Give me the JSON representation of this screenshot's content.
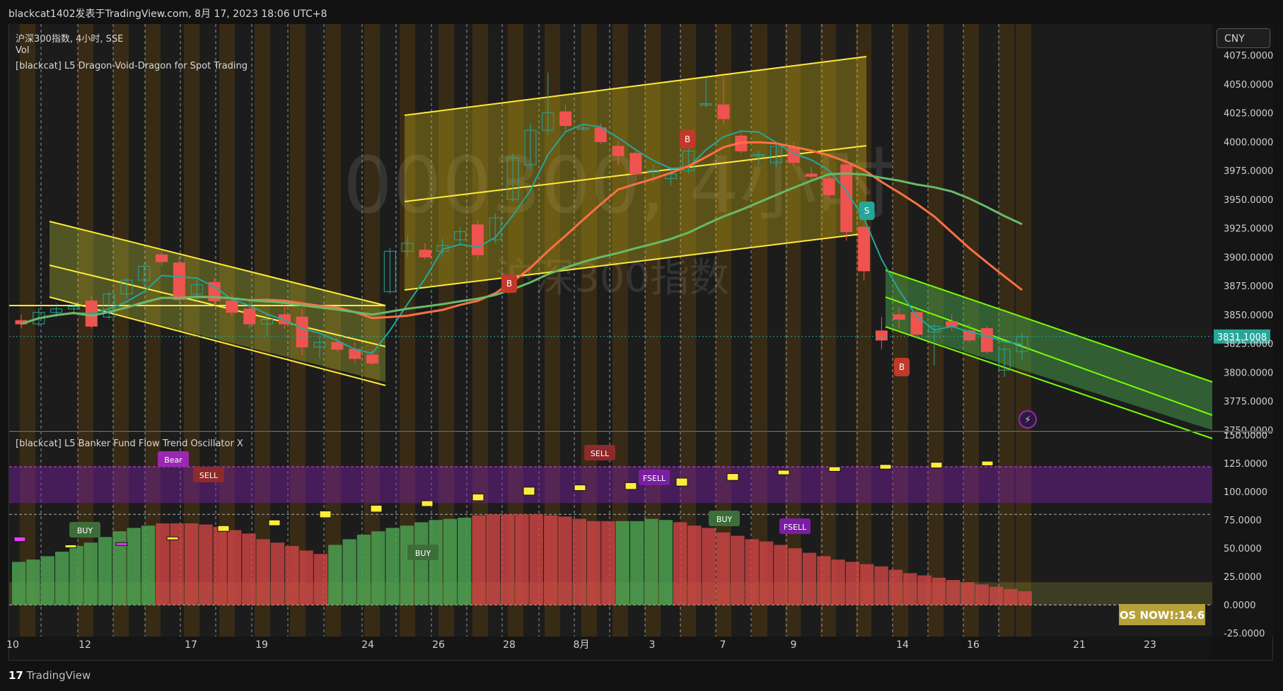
{
  "header": {
    "publisher": "blackcat1402发表于TradingView.com,  8月 17, 2023 18:06 UTC+8"
  },
  "legend": {
    "symbol": "沪深300指数, 4小时, SSE",
    "vol": "Vol",
    "indicator1": "[blackcat] L5 Dragon-Void-Dragon for Spot Trading",
    "indicator2": "[blackcat] L5 Banker Fund Flow Trend Oscillator X"
  },
  "currency": "CNY",
  "watermark": {
    "line1": "000300, 4小时",
    "line2": "沪深300指数"
  },
  "footer": {
    "brand": "TradingView"
  },
  "colors": {
    "up": "#26a69a",
    "down": "#ef5350",
    "yellow_channel": "#ffeb3b",
    "green_channel": "#76ff03",
    "price_tag": "#26a69a"
  },
  "chart_data": [
    {
      "type": "candlestick",
      "title": "沪深300指数, 4小时, SSE",
      "x_ticks": [
        "10",
        "12",
        "17",
        "19",
        "24",
        "26",
        "28",
        "8月",
        "3",
        "7",
        "9",
        "14",
        "16",
        "21",
        "23"
      ],
      "y_ticks": [
        3750,
        3775,
        3800,
        3825,
        3850,
        3875,
        3900,
        3925,
        3950,
        3975,
        4000,
        4025,
        4050,
        4075
      ],
      "ylim": [
        3750,
        4080
      ],
      "last_price": {
        "value": "3831.1008"
      },
      "candles": [
        [
          3845,
          3850,
          3838,
          3842
        ],
        [
          3842,
          3856,
          3840,
          3852
        ],
        [
          3852,
          3860,
          3848,
          3855
        ],
        [
          3855,
          3860,
          3850,
          3857
        ],
        [
          3862,
          3866,
          3838,
          3840
        ],
        [
          3848,
          3870,
          3846,
          3868
        ],
        [
          3868,
          3882,
          3864,
          3880
        ],
        [
          3880,
          3895,
          3876,
          3892
        ],
        [
          3902,
          3906,
          3892,
          3896
        ],
        [
          3895,
          3900,
          3860,
          3863
        ],
        [
          3868,
          3880,
          3862,
          3876
        ],
        [
          3878,
          3882,
          3858,
          3862
        ],
        [
          3862,
          3868,
          3848,
          3852
        ],
        [
          3855,
          3862,
          3838,
          3842
        ],
        [
          3842,
          3852,
          3832,
          3846
        ],
        [
          3850,
          3860,
          3838,
          3842
        ],
        [
          3848,
          3855,
          3815,
          3822
        ],
        [
          3822,
          3832,
          3812,
          3826
        ],
        [
          3826,
          3830,
          3818,
          3820
        ],
        [
          3820,
          3826,
          3808,
          3812
        ],
        [
          3815,
          3820,
          3806,
          3808
        ],
        [
          3870,
          3908,
          3868,
          3905
        ],
        [
          3905,
          3918,
          3900,
          3912
        ],
        [
          3906,
          3912,
          3898,
          3900
        ],
        [
          3905,
          3916,
          3900,
          3910
        ],
        [
          3915,
          3926,
          3910,
          3922
        ],
        [
          3928,
          3932,
          3898,
          3902
        ],
        [
          3915,
          3938,
          3912,
          3934
        ],
        [
          3950,
          3990,
          3948,
          3986
        ],
        [
          3980,
          4016,
          3976,
          4010
        ],
        [
          4010,
          4060,
          4006,
          4025
        ],
        [
          4026,
          4032,
          4010,
          4014
        ],
        [
          4012,
          4015,
          4010,
          4012
        ],
        [
          4012,
          4016,
          3998,
          4000
        ],
        [
          3996,
          4000,
          3980,
          3988
        ],
        [
          3990,
          3992,
          3966,
          3972
        ],
        [
          3974,
          3980,
          3965,
          3975
        ],
        [
          3968,
          3978,
          3962,
          3972
        ],
        [
          3975,
          3995,
          3972,
          3992
        ],
        [
          4032,
          4055,
          4030,
          4033
        ],
        [
          4032,
          4056,
          4015,
          4020
        ],
        [
          4005,
          4008,
          3990,
          3992
        ],
        [
          3988,
          3992,
          3980,
          3989
        ],
        [
          3982,
          3998,
          3978,
          3996
        ],
        [
          3995,
          4000,
          3978,
          3982
        ],
        [
          3972,
          3978,
          3966,
          3970
        ],
        [
          3968,
          3972,
          3950,
          3954
        ],
        [
          3980,
          3986,
          3914,
          3922
        ],
        [
          3926,
          3928,
          3880,
          3888
        ],
        [
          3836,
          3848,
          3820,
          3828
        ],
        [
          3850,
          3856,
          3838,
          3846
        ],
        [
          3852,
          3855,
          3830,
          3833
        ],
        [
          3835,
          3842,
          3806,
          3840
        ],
        [
          3844,
          3850,
          3836,
          3840
        ],
        [
          3836,
          3842,
          3826,
          3828
        ],
        [
          3838,
          3840,
          3816,
          3818
        ],
        [
          3802,
          3822,
          3796,
          3820
        ],
        [
          3818,
          3834,
          3810,
          3831
        ]
      ],
      "signals": [
        "B",
        "B",
        "B",
        "S"
      ]
    },
    {
      "type": "bar",
      "title": "[blackcat] L5 Banker Fund Flow Trend Oscillator X",
      "y_ticks": [
        -25,
        0,
        25,
        50,
        75,
        100,
        125,
        150
      ],
      "ylim": [
        -28,
        152
      ],
      "trend_values": [
        38,
        40,
        43,
        47,
        52,
        55,
        60,
        65,
        68,
        70,
        72,
        72,
        72,
        71,
        69,
        66,
        63,
        58,
        55,
        52,
        48,
        45,
        53,
        58,
        62,
        65,
        68,
        70,
        73,
        75,
        76,
        77,
        79,
        80,
        80,
        80,
        80,
        79,
        78,
        76,
        74,
        74,
        74,
        74,
        76,
        75,
        73,
        70,
        68,
        64,
        61,
        58,
        56,
        53,
        50,
        46,
        43,
        40,
        38,
        36,
        34,
        31,
        28,
        26,
        24,
        22,
        20,
        18,
        16,
        14,
        12
      ],
      "trend_colors": [
        "g",
        "g",
        "g",
        "g",
        "g",
        "g",
        "g",
        "g",
        "g",
        "g",
        "r",
        "r",
        "r",
        "r",
        "r",
        "r",
        "r",
        "r",
        "r",
        "r",
        "r",
        "r",
        "g",
        "g",
        "g",
        "g",
        "g",
        "g",
        "g",
        "g",
        "g",
        "g",
        "r",
        "r",
        "r",
        "r",
        "r",
        "r",
        "r",
        "r",
        "r",
        "r",
        "g",
        "g",
        "g",
        "g",
        "r",
        "r",
        "r",
        "r",
        "r",
        "r",
        "r",
        "r",
        "r",
        "r",
        "r",
        "r",
        "r",
        "r",
        "r",
        "r",
        "r",
        "r",
        "r",
        "r",
        "r",
        "r",
        "r",
        "r",
        "r"
      ],
      "bubbles": [
        [
          60,
          56
        ],
        [
          53,
          53
        ],
        [
          55,
          54
        ],
        [
          58,
          60
        ],
        [
          65,
          70
        ],
        [
          70,
          75
        ],
        [
          77,
          83
        ],
        [
          82,
          88
        ],
        [
          87,
          92
        ],
        [
          92,
          98
        ],
        [
          97,
          104
        ],
        [
          101,
          106
        ],
        [
          102,
          108
        ],
        [
          105,
          112
        ],
        [
          110,
          116
        ],
        [
          115,
          119
        ],
        [
          118,
          122
        ],
        [
          120,
          124
        ],
        [
          121,
          126
        ],
        [
          123,
          127
        ]
      ],
      "labels": [
        "Bear",
        "SELL",
        "BUY",
        "SELL",
        "FSELL",
        "BUY",
        "FSELL",
        "BUY"
      ],
      "os_now": "OS NOW!:14.6"
    }
  ],
  "axis": {
    "price_label": "3831.1008"
  }
}
